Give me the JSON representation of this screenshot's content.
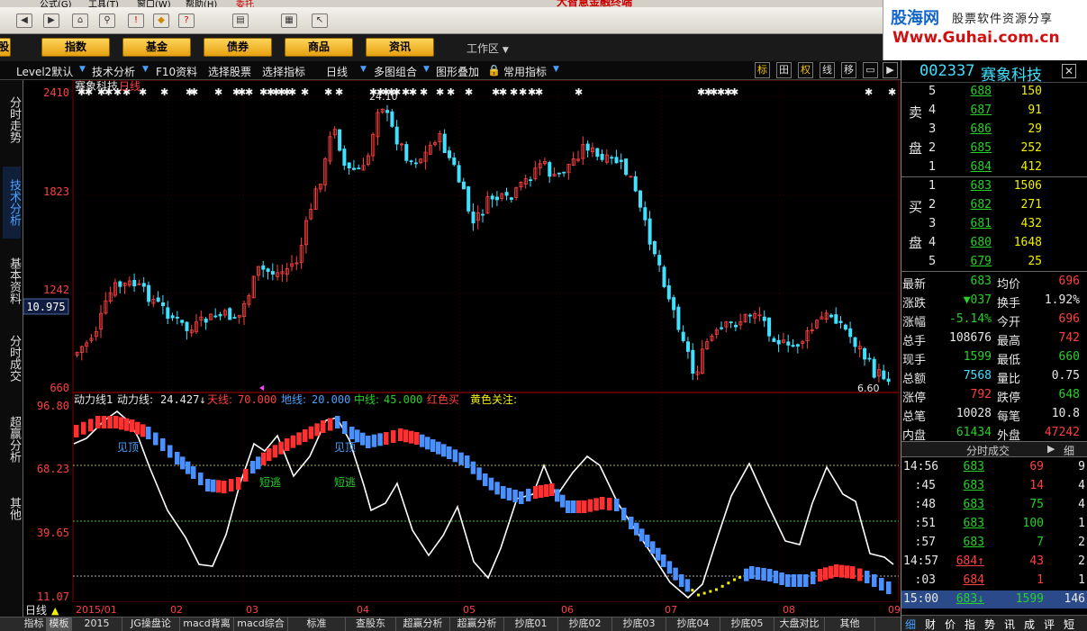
{
  "menu": {
    "items": [
      "公式(G)",
      "工具(T)",
      "窗口(W)",
      "帮助(H)",
      "委托"
    ],
    "app_title": "大智慧金融终端"
  },
  "toolbar": {
    "icons": [
      "back-icon",
      "forward-icon",
      "home-icon",
      "search-icon",
      "alert-icon",
      "trade-icon",
      "help-icon",
      "print-icon",
      "table-icon",
      "pointer-help-icon"
    ]
  },
  "brand": {
    "name": "股海网",
    "tagline": "股票软件资源分享",
    "url": "Www.Guhai.com.cn"
  },
  "nav": {
    "partial_label": "股",
    "items": [
      "指数",
      "基金",
      "债券",
      "商品",
      "资讯"
    ],
    "workarea": "工作区"
  },
  "subbar": {
    "items": [
      "Level2默认",
      "技术分析",
      "F10资料",
      "选择股票",
      "选择指标",
      "日线",
      "多图组合",
      "图形叠加",
      "常用指标"
    ],
    "buttons": [
      "标",
      "田",
      "权",
      "线",
      "移"
    ]
  },
  "side_tabs": [
    "分时走势",
    "技术分析",
    "基本资料",
    "分时成交",
    "超赢分析",
    "其他"
  ],
  "chart_main": {
    "stock_label": "赛象科技",
    "period_label": "日线",
    "price_labels": [
      "2410",
      "1823",
      "1242",
      "660"
    ],
    "current_price_label": "10.975",
    "high_marker": "24.10",
    "low_marker": "6.60",
    "period_indicator": "日线",
    "month_labels": [
      "2015/01",
      "02",
      "03",
      "04",
      "05",
      "06",
      "07",
      "08",
      "09"
    ]
  },
  "chart_ind": {
    "title": "动力线1",
    "legend": [
      {
        "label": "动力线:",
        "value": "24.427↓",
        "color": "#ffffff"
      },
      {
        "label": "天线:",
        "value": "70.000",
        "color": "#ff4040"
      },
      {
        "label": "地线:",
        "value": "20.000",
        "color": "#4aa0ff"
      },
      {
        "label": "中线:",
        "value": "45.000",
        "color": "#28d028"
      },
      {
        "label": "红色买",
        "value": "",
        "color": "#ff4040"
      },
      {
        "label": "黄色关注:",
        "value": "",
        "color": "#f0f000"
      }
    ],
    "y_labels": [
      "96.80",
      "68.23",
      "39.65",
      "11.07"
    ],
    "annotations": [
      "见顶",
      "短逃",
      "见顶",
      "短逃"
    ]
  },
  "quote": {
    "code": "002337",
    "name": "赛象科技",
    "sell": [
      {
        "level": "5",
        "price": "688",
        "vol": "150"
      },
      {
        "level": "4",
        "price": "687",
        "vol": "91"
      },
      {
        "level": "3",
        "price": "686",
        "vol": "29"
      },
      {
        "level": "2",
        "price": "685",
        "vol": "252"
      },
      {
        "level": "1",
        "price": "684",
        "vol": "412"
      }
    ],
    "buy": [
      {
        "level": "1",
        "price": "683",
        "vol": "1506"
      },
      {
        "level": "2",
        "price": "682",
        "vol": "271"
      },
      {
        "level": "3",
        "price": "681",
        "vol": "432"
      },
      {
        "level": "4",
        "price": "680",
        "vol": "1648"
      },
      {
        "level": "5",
        "price": "679",
        "vol": "25"
      }
    ],
    "sell_label": [
      "卖",
      "盘"
    ],
    "buy_label": [
      "买",
      "盘"
    ],
    "stats": [
      {
        "l1": "最新",
        "v1": "683",
        "l2": "均价",
        "v2": "696",
        "c1": "green",
        "c2": "red"
      },
      {
        "l1": "涨跌",
        "v1": "▼037",
        "l2": "换手",
        "v2": "1.92%",
        "c1": "green",
        "c2": "white"
      },
      {
        "l1": "涨幅",
        "v1": "-5.14%",
        "l2": "今开",
        "v2": "696",
        "c1": "green",
        "c2": "red"
      },
      {
        "l1": "总手",
        "v1": "108676",
        "l2": "最高",
        "v2": "742",
        "c1": "white",
        "c2": "red"
      },
      {
        "l1": "现手",
        "v1": "1599",
        "l2": "最低",
        "v2": "660",
        "c1": "green",
        "c2": "green"
      },
      {
        "l1": "总额",
        "v1": "7568",
        "l2": "量比",
        "v2": "0.75",
        "c1": "cyan",
        "c2": "white"
      },
      {
        "l1": "涨停",
        "v1": "792",
        "l2": "跌停",
        "v2": "648",
        "c1": "red",
        "c2": "green"
      },
      {
        "l1": "总笔",
        "v1": "10028",
        "l2": "每笔",
        "v2": "10.8",
        "c1": "white",
        "c2": "white"
      },
      {
        "l1": "内盘",
        "v1": "61434",
        "l2": "外盘",
        "v2": "47242",
        "c1": "green",
        "c2": "red"
      }
    ],
    "ticks_header": "分时成交",
    "ticks_btn": "细",
    "ticks": [
      {
        "time": "14:56",
        "price": "683",
        "vol": "69",
        "n": "9",
        "pc": "green",
        "vc": "red"
      },
      {
        "time": ":45",
        "price": "683",
        "vol": "14",
        "n": "4",
        "pc": "green",
        "vc": "red"
      },
      {
        "time": ":48",
        "price": "683",
        "vol": "75",
        "n": "4",
        "pc": "green",
        "vc": "green"
      },
      {
        "time": ":51",
        "price": "683",
        "vol": "100",
        "n": "1",
        "pc": "green",
        "vc": "green"
      },
      {
        "time": ":57",
        "price": "683",
        "vol": "7",
        "n": "2",
        "pc": "green",
        "vc": "green"
      },
      {
        "time": "14:57",
        "price": "684↑",
        "vol": "43",
        "n": "2",
        "pc": "red",
        "vc": "red"
      },
      {
        "time": ":03",
        "price": "684",
        "vol": "1",
        "n": "1",
        "pc": "red",
        "vc": "red"
      },
      {
        "time": "15:00",
        "price": "683↓",
        "vol": "1599",
        "n": "146",
        "pc": "green",
        "vc": "green"
      }
    ]
  },
  "bottom_tabs": [
    "指标",
    "模板",
    "2015",
    "JG操盘论",
    "macd背离",
    "macd综合",
    "标准",
    "查股东",
    "超赢分析",
    "超赢分析",
    "抄底01",
    "抄底02",
    "抄底03",
    "抄底04",
    "抄底05",
    "大盘对比",
    "其他"
  ],
  "right_bottom_tabs": [
    "细",
    "财",
    "价",
    "指",
    "势",
    "讯",
    "成",
    "评",
    "短"
  ],
  "chart_data": {
    "type": "line",
    "x": [
      "2015/01",
      "02",
      "03",
      "04",
      "05",
      "06",
      "07",
      "08",
      "09"
    ],
    "ind_ylim": [
      11.07,
      96.8
    ],
    "price_ylim": [
      6.6,
      24.1
    ],
    "levels": {
      "天线": 70,
      "中线": 45,
      "地线": 20
    }
  }
}
